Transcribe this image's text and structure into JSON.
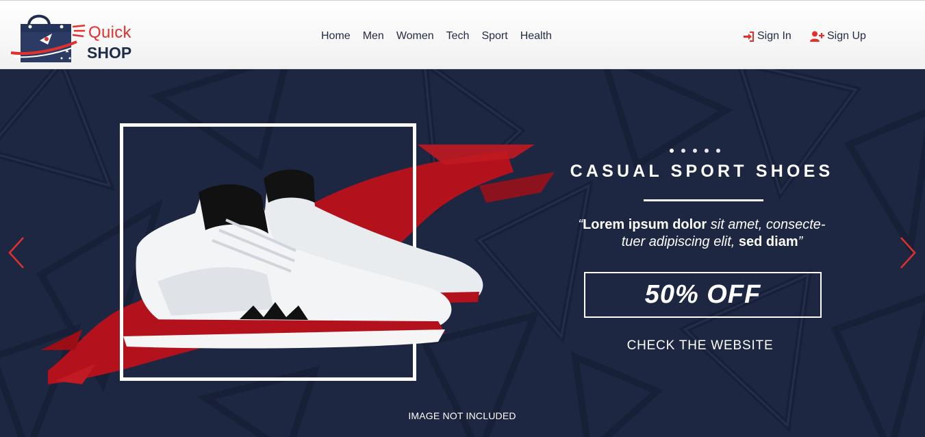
{
  "brand": {
    "name_line1": "Quick",
    "name_line2": "SHOP",
    "accent": "#e2302d",
    "navy": "#1f2d4b",
    "logo_icon": "shopping-bag-rocket-icon"
  },
  "nav": {
    "items": [
      {
        "label": "Home"
      },
      {
        "label": "Men"
      },
      {
        "label": "Women"
      },
      {
        "label": "Tech"
      },
      {
        "label": "Sport"
      },
      {
        "label": "Health"
      }
    ]
  },
  "auth": {
    "sign_in": {
      "label": "Sign In",
      "icon": "sign-in-icon"
    },
    "sign_up": {
      "label": "Sign Up",
      "icon": "user-plus-icon"
    },
    "icon_color": "#e2302d"
  },
  "hero": {
    "background": "#1e2741",
    "slide_count": 5,
    "active_slide": 1,
    "title": "CASUAL SPORT SHOES",
    "quote_line1_bold": "Lorem ipsum dolor",
    "quote_line1_rest": " sit amet, consecte-",
    "quote_line2_rest": "tuer adipiscing elit, ",
    "quote_line2_bold": "sed diam",
    "open_quote": "“",
    "close_quote": "”",
    "discount": "50% OFF",
    "cta": "CHECK THE WEBSITE",
    "notice": "IMAGE NOT INCLUDED",
    "prev_icon": "chevron-left-icon",
    "next_icon": "chevron-right-icon",
    "arrow_color": "#e2302d"
  }
}
